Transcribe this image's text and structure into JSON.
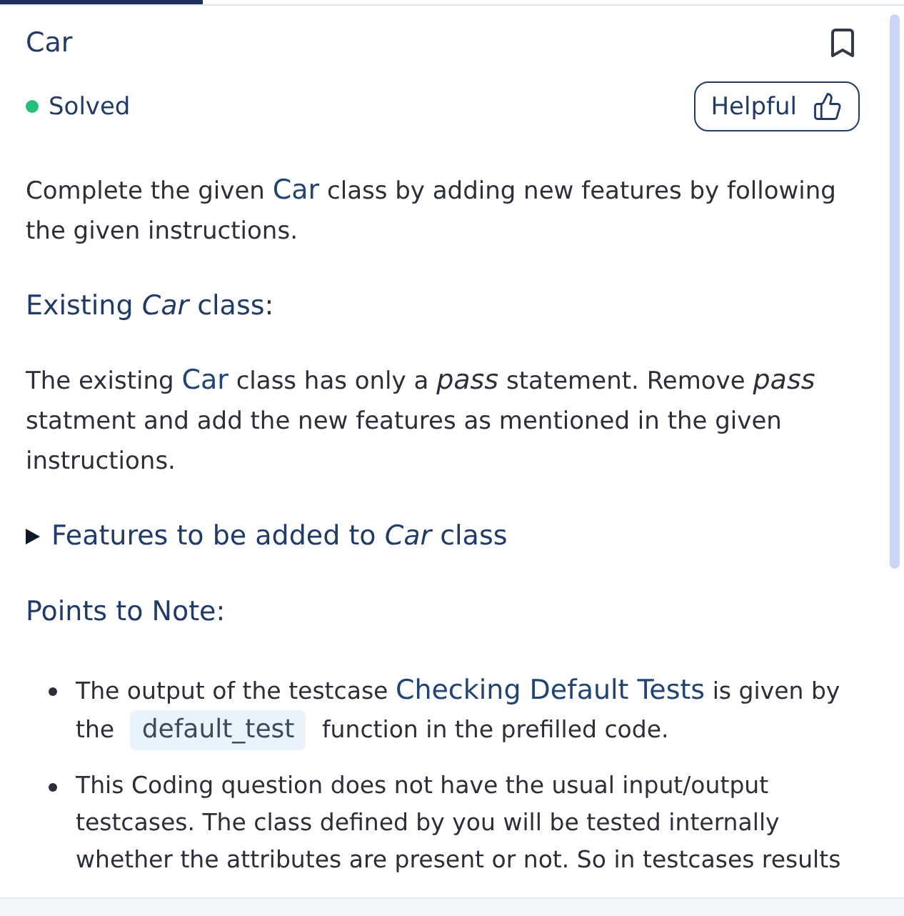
{
  "problem": {
    "title": "Car",
    "status": "Solved",
    "helpful": "Helpful"
  },
  "blocks": [
    {
      "kind": "paragraph",
      "segments": [
        {
          "kind": "text",
          "text": "Complete the given "
        },
        {
          "kind": "class",
          "text": "Car"
        },
        {
          "kind": "text",
          "text": " class by adding new features by following the given instructions."
        }
      ]
    },
    {
      "kind": "heading",
      "segments": [
        {
          "kind": "text",
          "text": "Existing "
        },
        {
          "kind": "em",
          "text": "Car"
        },
        {
          "kind": "text",
          "text": " class"
        },
        {
          "kind": "plain",
          "text": ":"
        }
      ]
    },
    {
      "kind": "paragraph",
      "segments": [
        {
          "kind": "text",
          "text": "The existing "
        },
        {
          "kind": "class",
          "text": "Car"
        },
        {
          "kind": "text",
          "text": " class has only a "
        },
        {
          "kind": "em",
          "text": "pass"
        },
        {
          "kind": "text",
          "text": " statement. Remove "
        },
        {
          "kind": "em",
          "text": "pass"
        },
        {
          "kind": "text",
          "text": " statment and add the new features as mentioned in the given instructions."
        }
      ]
    },
    {
      "kind": "disclosure",
      "expanded": false,
      "segments": [
        {
          "kind": "text",
          "text": "Features to be added to "
        },
        {
          "kind": "em",
          "text": "Car"
        },
        {
          "kind": "text",
          "text": " class"
        }
      ]
    },
    {
      "kind": "heading",
      "segments": [
        {
          "kind": "text",
          "text": "Points to Note:"
        }
      ]
    },
    {
      "kind": "list",
      "items": [
        {
          "segments": [
            {
              "kind": "text",
              "text": "The output of the testcase "
            },
            {
              "kind": "class",
              "text": "Checking Default Tests"
            },
            {
              "kind": "text",
              "text": " is given by the "
            },
            {
              "kind": "code",
              "text": "default_test"
            },
            {
              "kind": "text",
              "text": " function in the prefilled code."
            }
          ]
        },
        {
          "segments": [
            {
              "kind": "text",
              "text": "This Coding question does not have the usual input/output testcases. The class defined by you will be tested internally whether the attributes are present or not. So in testcases results"
            }
          ]
        }
      ]
    }
  ]
}
